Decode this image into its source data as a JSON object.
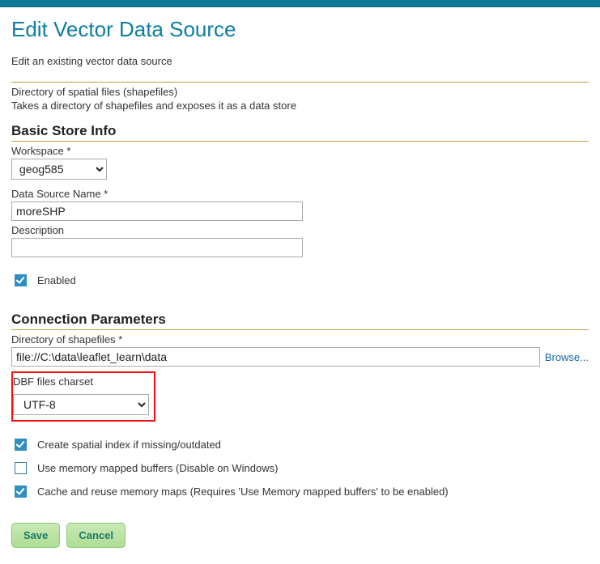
{
  "header": {
    "title": "Edit Vector Data Source",
    "subtitle": "Edit an existing vector data source"
  },
  "storeType": {
    "line1": "Directory of spatial files (shapefiles)",
    "line2": "Takes a directory of shapefiles and exposes it as a data store"
  },
  "basic": {
    "heading": "Basic Store Info",
    "workspace_label": "Workspace *",
    "workspace_value": "geog585",
    "dsname_label": "Data Source Name *",
    "dsname_value": "moreSHP",
    "description_label": "Description",
    "description_value": "",
    "enabled_label": "Enabled",
    "enabled_checked": true
  },
  "conn": {
    "heading": "Connection Parameters",
    "dir_label": "Directory of shapefiles *",
    "dir_value": "file://C:\\data\\leaflet_learn\\data",
    "browse_label": "Browse...",
    "charset_label": "DBF files charset",
    "charset_value": "UTF-8",
    "opt_spatial_index": {
      "label": "Create spatial index if missing/outdated",
      "checked": true
    },
    "opt_memory_mapped": {
      "label": "Use memory mapped buffers (Disable on Windows)",
      "checked": false
    },
    "opt_cache_reuse": {
      "label": "Cache and reuse memory maps (Requires 'Use Memory mapped buffers' to be enabled)",
      "checked": true
    }
  },
  "buttons": {
    "save": "Save",
    "cancel": "Cancel"
  }
}
